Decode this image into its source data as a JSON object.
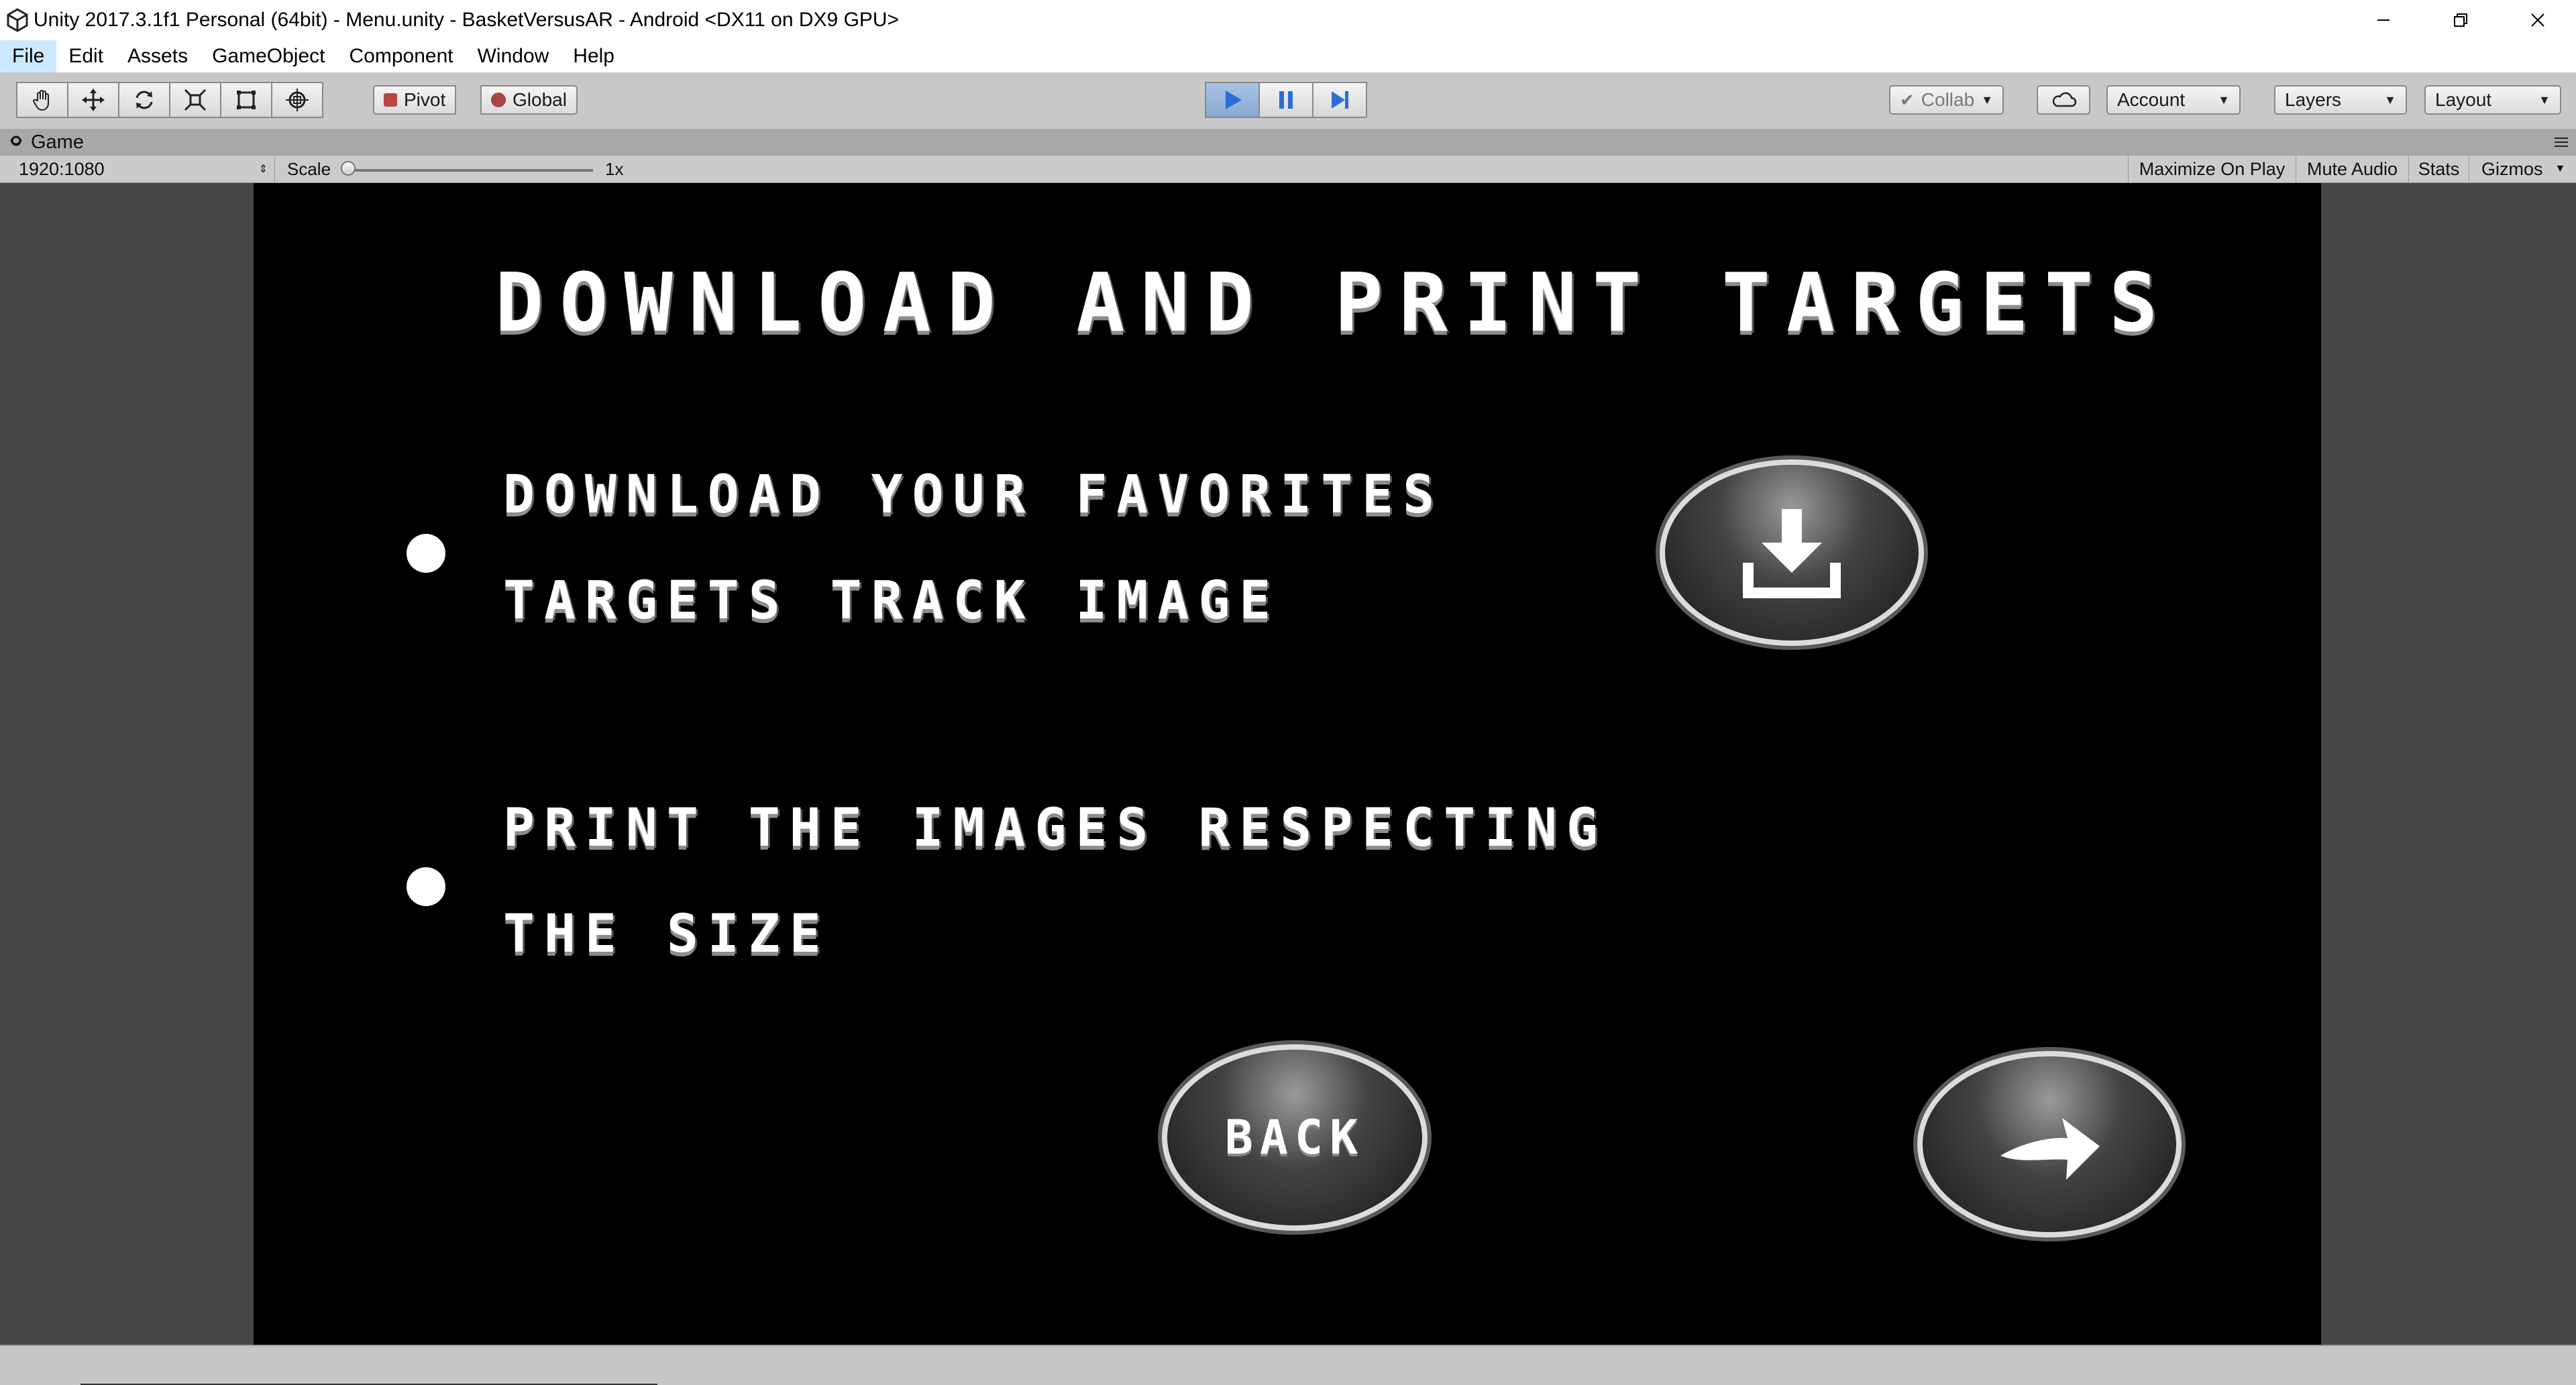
{
  "window": {
    "title": "Unity 2017.3.1f1 Personal (64bit) - Menu.unity - BasketVersusAR - Android <DX11 on DX9 GPU>"
  },
  "menu": {
    "items": [
      {
        "label": "File"
      },
      {
        "label": "Edit"
      },
      {
        "label": "Assets"
      },
      {
        "label": "GameObject"
      },
      {
        "label": "Component"
      },
      {
        "label": "Window"
      },
      {
        "label": "Help"
      }
    ]
  },
  "toolbar": {
    "tools": [
      "hand-icon",
      "move-icon",
      "rotate-icon",
      "scale-icon",
      "rect-icon",
      "transform-icon"
    ],
    "pivot_label": "Pivot",
    "global_label": "Global",
    "collab_label": "Collab",
    "account_label": "Account",
    "layers_label": "Layers",
    "layout_label": "Layout",
    "play_state": "playing",
    "accent": "#2a6fd6"
  },
  "tab": {
    "label": "Game"
  },
  "gamebar": {
    "resolution": "1920:1080",
    "scale_label": "Scale",
    "scale_value": "1x",
    "maximize_label": "Maximize On Play",
    "mute_label": "Mute Audio",
    "stats_label": "Stats",
    "gizmos_label": "Gizmos"
  },
  "game": {
    "heading": "DOWNLOAD AND PRINT TARGETS",
    "items": [
      {
        "line1": "DOWNLOAD YOUR FAVORITES",
        "line2": "TARGETS TRACK IMAGE"
      },
      {
        "line1": "PRINT THE IMAGES RESPECTING",
        "line2": "THE SIZE"
      }
    ],
    "download_icon": "download-icon",
    "back_label": "BACK",
    "next_icon": "arrow-right-icon"
  }
}
